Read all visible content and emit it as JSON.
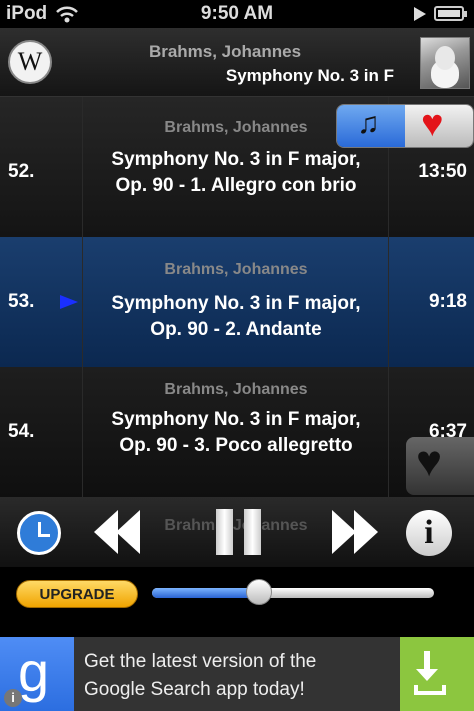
{
  "status_bar": {
    "device": "iPod",
    "time": "9:50 AM"
  },
  "now_playing": {
    "composer": "Brahms, Johannes",
    "title": "Symphony No. 3 in F",
    "wiki_label": "W",
    "icons": {
      "wiki": "wikipedia-icon",
      "portrait": "composer-portrait"
    }
  },
  "tracks": [
    {
      "number": "52.",
      "composer": "Brahms, Johannes",
      "title_line1": "Symphony No. 3 in F major,",
      "title_line2": "Op. 90 - 1. Allegro con brio",
      "duration": "13:50",
      "playing": false
    },
    {
      "number": "53.",
      "composer": "Brahms, Johannes",
      "title_line1": "Symphony No. 3 in F major,",
      "title_line2": "Op. 90 - 2. Andante",
      "duration": "9:18",
      "playing": true
    },
    {
      "number": "54.",
      "composer": "Brahms, Johannes",
      "title_line1": "Symphony No. 3 in F major,",
      "title_line2": "Op. 90 - 3. Poco allegretto",
      "duration": "6:37",
      "playing": false
    }
  ],
  "transport": {
    "ghost_text": "Brahms, Johannes",
    "info_label": "i"
  },
  "upgrade": {
    "label": "UPGRADE"
  },
  "volume": {
    "level": 0.38
  },
  "colors": {
    "selected_row": "#0b2850",
    "accent_blue": "#2a6ad8",
    "heart_red": "#e3141a",
    "upgrade_gold": "#f0a400",
    "ad_green": "#8cc63f"
  },
  "ad": {
    "text_line1": "Get the latest version of the",
    "text_line2": "Google Search app today!",
    "logo_letter": "g",
    "info_label": "i"
  }
}
